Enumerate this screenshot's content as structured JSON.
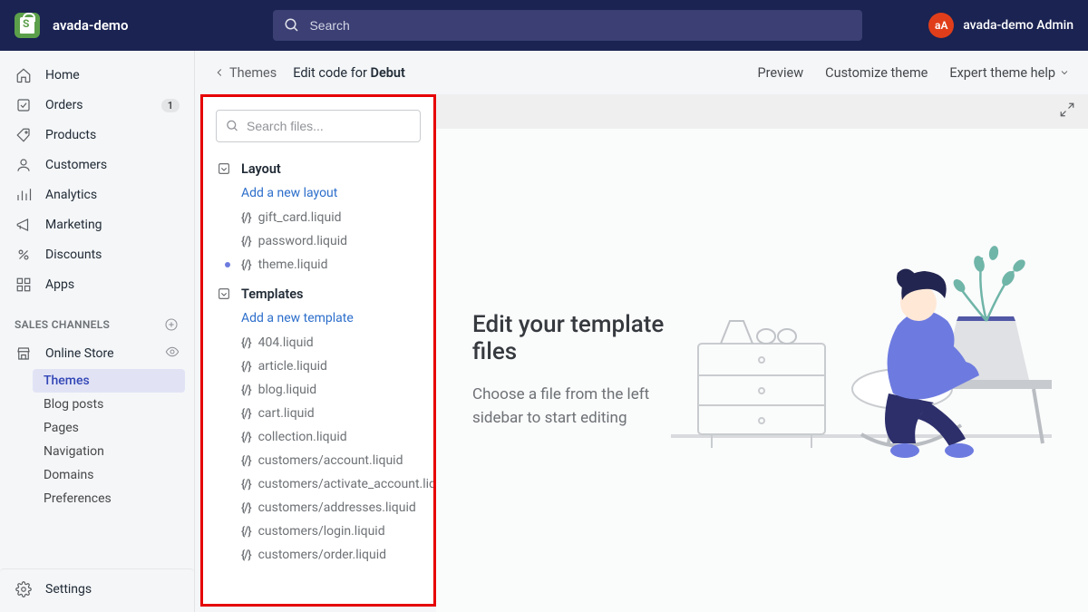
{
  "header": {
    "store_name": "avada-demo",
    "search_placeholder": "Search",
    "avatar_initials": "aA",
    "username": "avada-demo Admin"
  },
  "nav": {
    "items": [
      {
        "label": "Home",
        "icon": "home"
      },
      {
        "label": "Orders",
        "icon": "orders",
        "badge": "1"
      },
      {
        "label": "Products",
        "icon": "products"
      },
      {
        "label": "Customers",
        "icon": "customers"
      },
      {
        "label": "Analytics",
        "icon": "analytics"
      },
      {
        "label": "Marketing",
        "icon": "marketing"
      },
      {
        "label": "Discounts",
        "icon": "discounts"
      },
      {
        "label": "Apps",
        "icon": "apps"
      }
    ],
    "section_label": "SALES CHANNELS",
    "channel": {
      "label": "Online Store",
      "icon": "store"
    },
    "channel_subs": [
      {
        "label": "Themes",
        "active": true
      },
      {
        "label": "Blog posts"
      },
      {
        "label": "Pages"
      },
      {
        "label": "Navigation"
      },
      {
        "label": "Domains"
      },
      {
        "label": "Preferences"
      }
    ],
    "settings_label": "Settings"
  },
  "subheader": {
    "back_label": "Themes",
    "title_prefix": "Edit code for ",
    "theme_name": "Debut",
    "actions": {
      "preview": "Preview",
      "customize": "Customize theme",
      "help": "Expert theme help"
    }
  },
  "files": {
    "search_placeholder": "Search files...",
    "sections": [
      {
        "title": "Layout",
        "add_label": "Add a new layout",
        "files": [
          {
            "name": "gift_card.liquid"
          },
          {
            "name": "password.liquid"
          },
          {
            "name": "theme.liquid",
            "modified": true
          }
        ]
      },
      {
        "title": "Templates",
        "add_label": "Add a new template",
        "files": [
          {
            "name": "404.liquid"
          },
          {
            "name": "article.liquid"
          },
          {
            "name": "blog.liquid"
          },
          {
            "name": "cart.liquid"
          },
          {
            "name": "collection.liquid"
          },
          {
            "name": "customers/account.liquid"
          },
          {
            "name": "customers/activate_account.liquid"
          },
          {
            "name": "customers/addresses.liquid"
          },
          {
            "name": "customers/login.liquid"
          },
          {
            "name": "customers/order.liquid"
          }
        ]
      }
    ]
  },
  "editor": {
    "heading": "Edit your template files",
    "subtext": "Choose a file from the left sidebar to start editing"
  }
}
